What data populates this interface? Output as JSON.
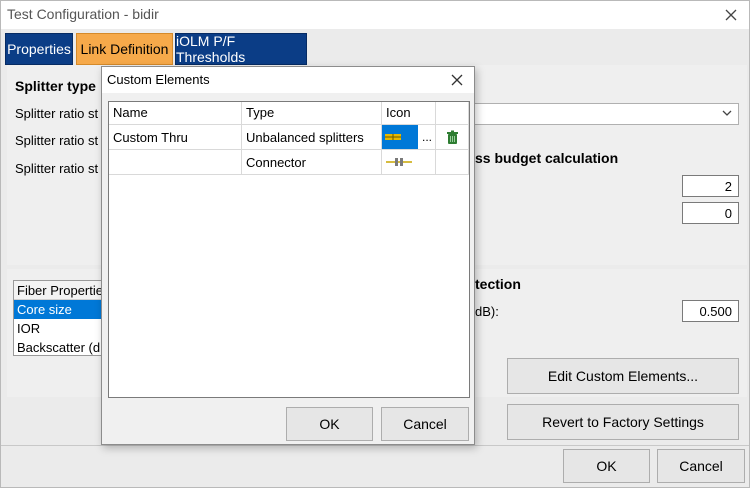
{
  "window": {
    "title": "Test Configuration - bidir"
  },
  "tabs": [
    {
      "label": "Properties",
      "active": false
    },
    {
      "label": "Link Definition",
      "active": true
    },
    {
      "label": "iOLM P/F Thresholds",
      "active": false
    }
  ],
  "splitter": {
    "title": "Splitter type",
    "labels": [
      "Splitter ratio st",
      "Splitter ratio st",
      "Splitter ratio st"
    ]
  },
  "loss_budget": {
    "title": "ss budget calculation",
    "value1": "2",
    "value2": "0"
  },
  "detection": {
    "title": "tection",
    "label": "dB):",
    "value": "0.500"
  },
  "fiber_properties": {
    "header": "Fiber Properties",
    "items": [
      "Core size",
      "IOR",
      "Backscatter (dE"
    ],
    "selected_index": 0
  },
  "buttons": {
    "edit_custom": "Edit Custom Elements...",
    "revert": "Revert to Factory Settings",
    "ok": "OK",
    "cancel": "Cancel"
  },
  "dialog": {
    "title": "Custom Elements",
    "columns": [
      "Name",
      "Type",
      "Icon"
    ],
    "rows": [
      {
        "name": "Custom Thru",
        "type": "Unbalanced splitters",
        "icon": "unbalanced-splitter-icon",
        "browse": "...",
        "delete_icon": "trash-icon"
      },
      {
        "name": "",
        "type": "Connector",
        "icon": "connector-icon"
      }
    ],
    "ok": "OK",
    "cancel": "Cancel"
  },
  "colors": {
    "tab_active": "#f6a94a",
    "tab_inactive": "#0b3d86",
    "selection": "#0078d7",
    "delete_icon": "#2e7d32"
  }
}
